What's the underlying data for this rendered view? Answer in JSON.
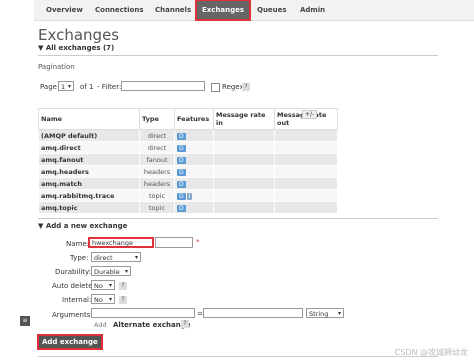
{
  "nav": {
    "overview": "Overview",
    "connections": "Connections",
    "channels": "Channels",
    "exchanges": "Exchanges",
    "queues": "Queues",
    "admin": "Admin"
  },
  "page_title": "Exchanges",
  "all_exchanges": "All exchanges (7)",
  "pagination": {
    "label": "Pagination",
    "page_label": "Page",
    "page_value": "1",
    "of_label": "of 1",
    "filter_label": "- Filter:",
    "filter_value": "",
    "regex_label": "Regex",
    "help": "?"
  },
  "table": {
    "headers": {
      "name": "Name",
      "type": "Type",
      "features": "Features",
      "rate_in": "Message rate in",
      "rate_out": "Message rate out",
      "toggle": "+/-"
    },
    "rows": [
      {
        "name": "(AMQP default)",
        "type": "direct",
        "features": [
          "D"
        ]
      },
      {
        "name": "amq.direct",
        "type": "direct",
        "features": [
          "D"
        ]
      },
      {
        "name": "amq.fanout",
        "type": "fanout",
        "features": [
          "D"
        ]
      },
      {
        "name": "amq.headers",
        "type": "headers",
        "features": [
          "D"
        ]
      },
      {
        "name": "amq.match",
        "type": "headers",
        "features": [
          "D"
        ]
      },
      {
        "name": "amq.rabbitmq.trace",
        "type": "topic",
        "features": [
          "D",
          "I"
        ]
      },
      {
        "name": "amq.topic",
        "type": "topic",
        "features": [
          "D"
        ]
      }
    ]
  },
  "add_section": "Add a new exchange",
  "form": {
    "name_label": "Name:",
    "name_value": "hwexchange",
    "required_mark": "*",
    "type_label": "Type:",
    "type_value": "direct",
    "durability_label": "Durability:",
    "durability_value": "Durable",
    "auto_delete_label": "Auto delete:",
    "auto_delete_value": "No",
    "internal_label": "Internal:",
    "internal_value": "No",
    "arguments_label": "Arguments:",
    "equals": "=",
    "arg_type_value": "String",
    "add_label": "Add",
    "alt_exchange_label": "Alternate exchange",
    "submit_label": "Add exchange",
    "help": "?"
  },
  "watermark": "CSDN @攻城狮幼龙"
}
